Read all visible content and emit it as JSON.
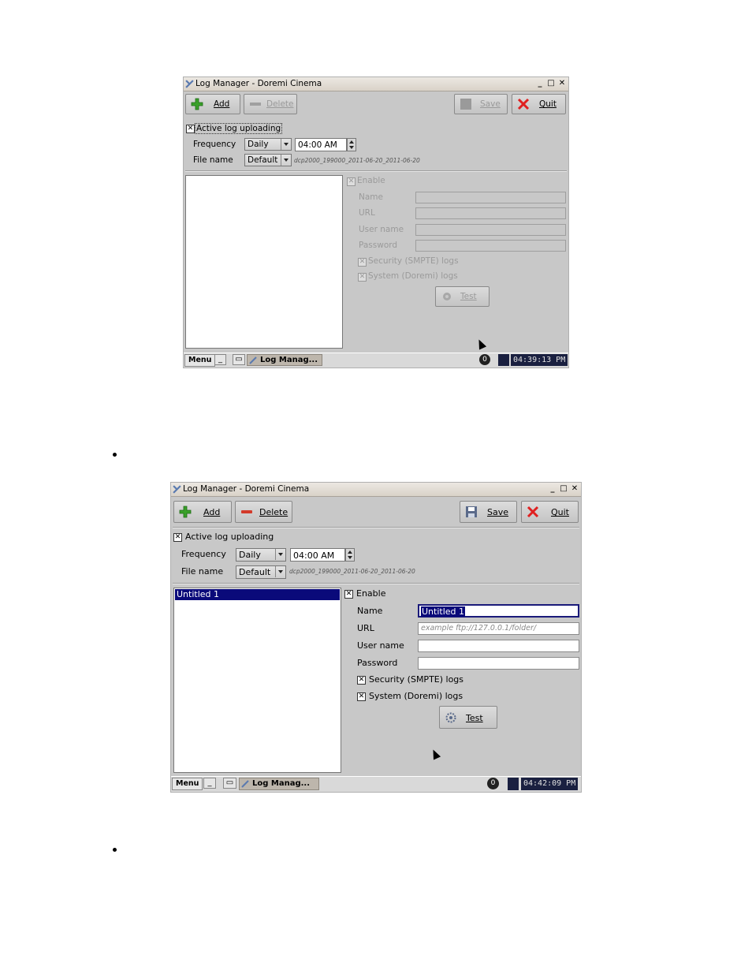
{
  "window": {
    "title": "Log Manager - Doremi Cinema",
    "minimize": "_",
    "maximize": "□",
    "close": "✕"
  },
  "toolbar": {
    "add": "Add",
    "delete": "Delete",
    "save": "Save",
    "quit": "Quit"
  },
  "settings": {
    "active_label": "Active log uploading",
    "frequency_label": "Frequency",
    "frequency_value": "Daily",
    "time_value": "04:00 AM",
    "filename_label": "File name",
    "filename_value": "Default",
    "filename_example": "dcp2000_199000_2011-06-20_2011-06-20"
  },
  "form": {
    "enable": "Enable",
    "name_label": "Name",
    "url_label": "URL",
    "user_label": "User name",
    "password_label": "Password",
    "security_logs": "Security (SMPTE) logs",
    "system_logs": "System (Doremi) logs",
    "test": "Test",
    "name_value": "Untitled 1",
    "url_placeholder": "example ftp://127.0.0.1/folder/"
  },
  "list": {
    "item1": "Untitled 1"
  },
  "taskbar": {
    "menu": "Menu",
    "task": "Log Manag...",
    "notify_count": "0",
    "clock1": "04:39:13 PM",
    "clock2": "04:42:09 PM"
  },
  "colors": {
    "window_bg": "#c8c8c8",
    "selection": "#0a0a7a",
    "add_green": "#3aa02a",
    "delete_red": "#d33a2a",
    "quit_red": "#e02020",
    "clock_bg": "#1a2040"
  }
}
